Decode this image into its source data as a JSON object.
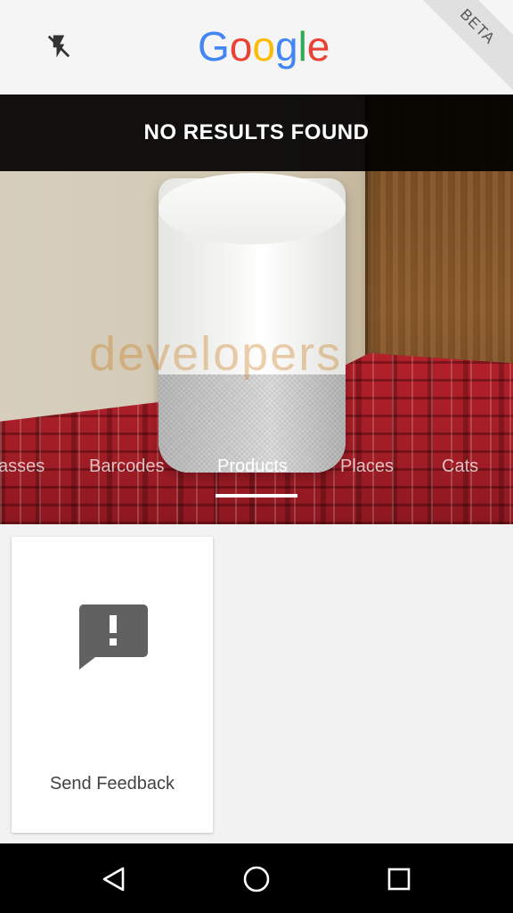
{
  "header": {
    "logo_letters": [
      "G",
      "o",
      "o",
      "g",
      "l",
      "e"
    ],
    "logo_colors": [
      "#4285F4",
      "#EA4335",
      "#FBBC05",
      "#4285F4",
      "#34A853",
      "#EA4335"
    ],
    "beta_label": "BETA",
    "flash_icon": "flash-off-icon"
  },
  "banner": {
    "text": "NO RESULTS FOUND"
  },
  "camera": {
    "watermark": "developers"
  },
  "tabs": [
    {
      "label": "asses"
    },
    {
      "label": "Barcodes"
    },
    {
      "label": "Products"
    },
    {
      "label": "Places"
    },
    {
      "label": "Cats"
    }
  ],
  "active_tab": "Products",
  "card": {
    "label": "Send Feedback",
    "icon": "feedback-icon"
  },
  "nav": {
    "back_icon": "back-triangle-icon",
    "home_icon": "home-circle-icon",
    "recents_icon": "recents-square-icon"
  }
}
